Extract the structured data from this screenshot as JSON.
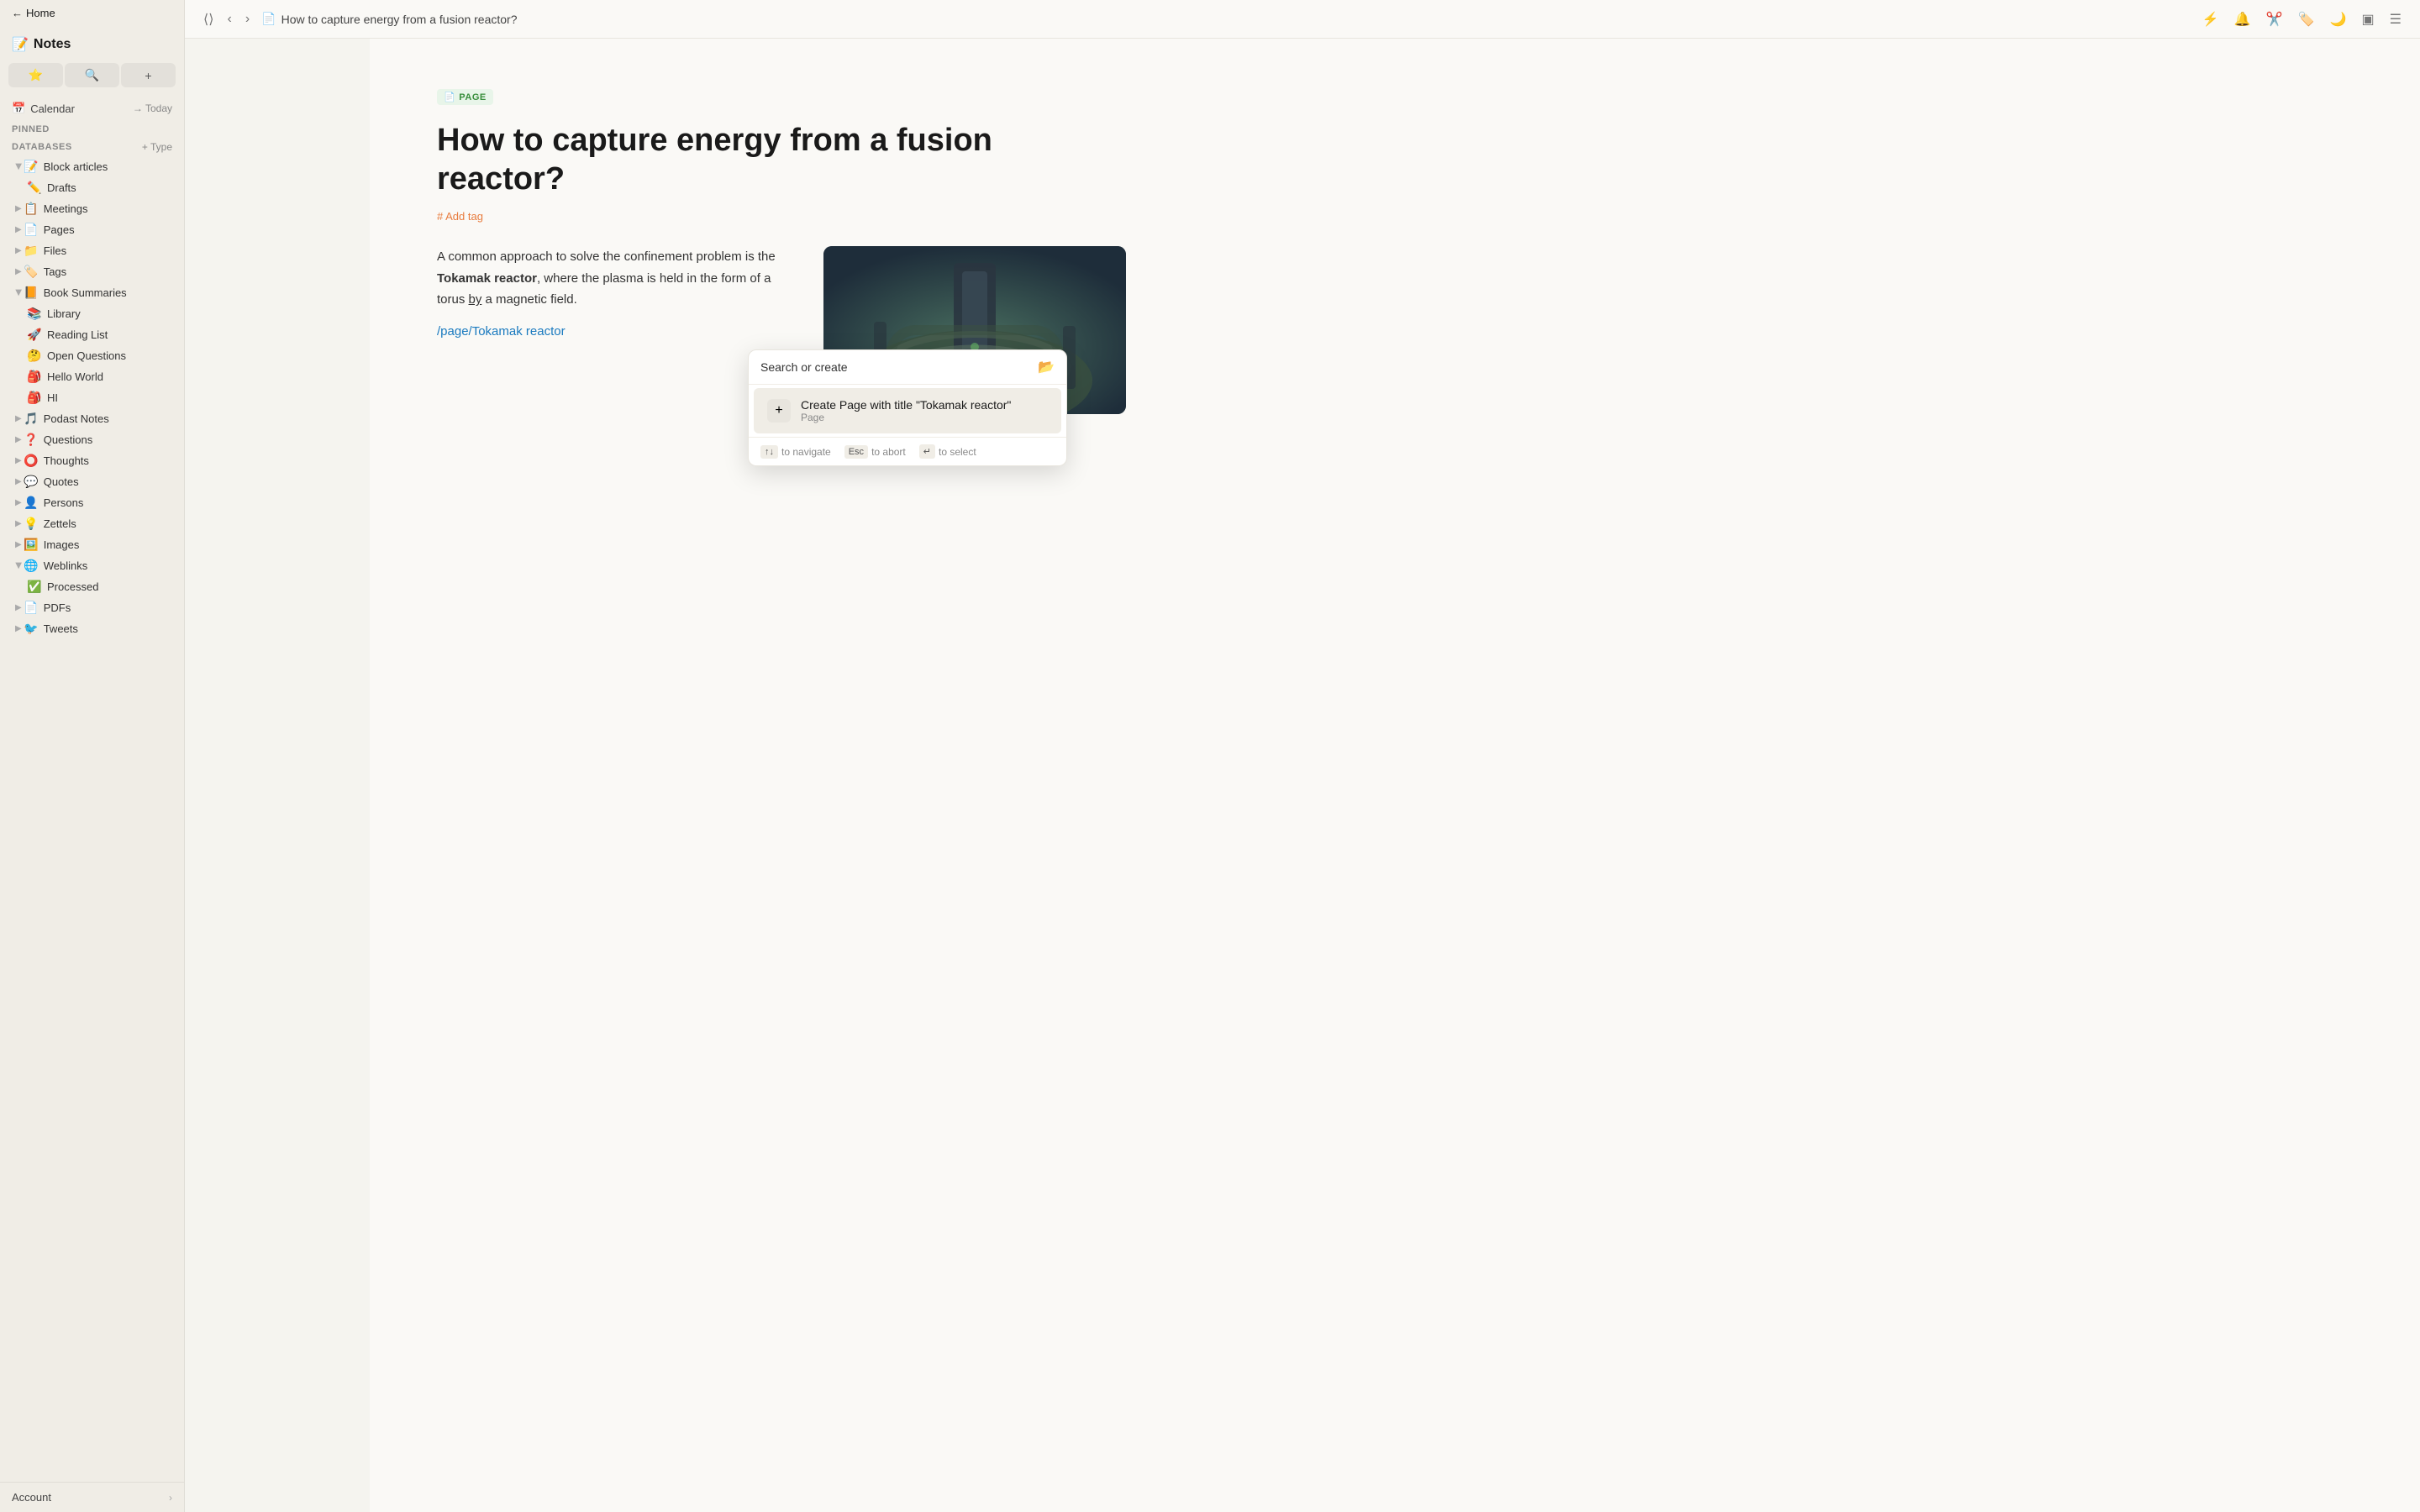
{
  "app": {
    "title": "Notes",
    "icon": "📝"
  },
  "topbar": {
    "title": "How to capture energy from a fusion reactor?",
    "title_icon": "📄"
  },
  "sidebar": {
    "home_label": "Home",
    "toolbar": {
      "highlight_icon": "★",
      "search_icon": "🔍",
      "new_icon": "+"
    },
    "calendar": {
      "icon": "📅",
      "label": "Calendar",
      "today_label": "→ Today"
    },
    "pinned_label": "PINNED",
    "databases_label": "DATABASES",
    "type_label": "+ Type",
    "sections": [
      {
        "icon": "📝",
        "label": "Block articles",
        "indent": 0,
        "expandable": true,
        "expanded": true
      },
      {
        "icon": "✏️",
        "label": "Drafts",
        "indent": 1,
        "expandable": false
      },
      {
        "icon": "📋",
        "label": "Meetings",
        "indent": 0,
        "expandable": true
      },
      {
        "icon": "📄",
        "label": "Pages",
        "indent": 0,
        "expandable": true
      },
      {
        "icon": "📁",
        "label": "Files",
        "indent": 0,
        "expandable": true
      },
      {
        "icon": "🏷️",
        "label": "Tags",
        "indent": 0,
        "expandable": true
      },
      {
        "icon": "📙",
        "label": "Book Summaries",
        "indent": 0,
        "expandable": true,
        "expanded": true
      },
      {
        "icon": "📚",
        "label": "Library",
        "indent": 1,
        "expandable": false
      },
      {
        "icon": "🚀",
        "label": "Reading List",
        "indent": 1,
        "expandable": false
      },
      {
        "icon": "🤔",
        "label": "Open Questions",
        "indent": 1,
        "expandable": false
      },
      {
        "icon": "🎒",
        "label": "Hello World",
        "indent": 1,
        "expandable": false
      },
      {
        "icon": "🎒",
        "label": "HI",
        "indent": 1,
        "expandable": false
      },
      {
        "icon": "🎵",
        "label": "Podast Notes",
        "indent": 0,
        "expandable": true
      },
      {
        "icon": "❓",
        "label": "Questions",
        "indent": 0,
        "expandable": true
      },
      {
        "icon": "⭕",
        "label": "Thoughts",
        "indent": 0,
        "expandable": true
      },
      {
        "icon": "💬",
        "label": "Quotes",
        "indent": 0,
        "expandable": true
      },
      {
        "icon": "👤",
        "label": "Persons",
        "indent": 0,
        "expandable": true
      },
      {
        "icon": "💡",
        "label": "Zettels",
        "indent": 0,
        "expandable": true
      },
      {
        "icon": "🖼️",
        "label": "Images",
        "indent": 0,
        "expandable": true
      },
      {
        "icon": "🌐",
        "label": "Weblinks",
        "indent": 0,
        "expandable": true,
        "expanded": true
      },
      {
        "icon": "✅",
        "label": "Processed",
        "indent": 1,
        "expandable": false
      },
      {
        "icon": "📄",
        "label": "PDFs",
        "indent": 0,
        "expandable": true
      },
      {
        "icon": "🐦",
        "label": "Tweets",
        "indent": 0,
        "expandable": true
      }
    ],
    "account_label": "Account"
  },
  "page": {
    "badge": "PAGE",
    "title": "How to capture energy from a fusion reactor?",
    "add_tag_label": "# Add tag",
    "body_text_1": "A common approach to solve the confinement problem is the ",
    "body_bold": "Tokamak reactor",
    "body_text_2": ", where the plasma is held in the form of a torus ",
    "body_underline": "by",
    "body_text_3": " a magnetic field.",
    "link_input": "/page/Tokamak reactor"
  },
  "dropdown": {
    "search_placeholder": "Search or create",
    "folder_icon": "📂",
    "option": {
      "icon": "+",
      "title": "Create Page with title \"Tokamak reactor\"",
      "subtitle": "Page"
    },
    "footer": {
      "navigate_keys": "↑↓",
      "navigate_label": "to navigate",
      "abort_key": "Esc",
      "abort_label": "to abort",
      "select_key": "↵",
      "select_label": "to select"
    }
  },
  "topbar_actions": {
    "icon1": "⚡",
    "icon2": "🔔",
    "icon3": "✂️",
    "icon4": "🏷️",
    "icon5": "🌙",
    "icon6": "📋",
    "icon7": "☰"
  }
}
